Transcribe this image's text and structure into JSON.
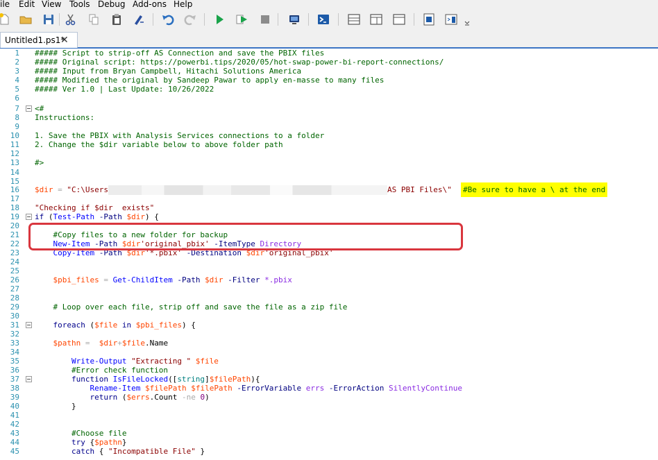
{
  "menubar": {
    "items": [
      "ile",
      "Edit",
      "View",
      "Tools",
      "Debug",
      "Add-ons",
      "Help"
    ]
  },
  "toolbar": {
    "buttons": [
      "new-file-icon",
      "open-folder-icon",
      "save-icon",
      "cut-icon",
      "copy-icon",
      "paste-icon",
      "clear-icon",
      "undo-icon",
      "redo-icon",
      "run-icon",
      "run-selection-icon",
      "stop-icon",
      "remote-powershell-icon",
      "powershell-console-icon",
      "layout-top-icon",
      "layout-right-icon",
      "layout-max-icon",
      "show-commands-icon",
      "command-addon-icon",
      "overflow-chevron-icon"
    ]
  },
  "tab": {
    "label": "Untitled1.ps1*",
    "close": "✕"
  },
  "editor": {
    "line_numbers": [
      "1",
      "2",
      "3",
      "4",
      "5",
      "6",
      "7",
      "8",
      "9",
      "10",
      "11",
      "12",
      "13",
      "14",
      "15",
      "16",
      "17",
      "18",
      "19",
      "20",
      "21",
      "22",
      "23",
      "24",
      "25",
      "26",
      "27",
      "28",
      "29",
      "30",
      "31",
      "32",
      "33",
      "34",
      "35",
      "36",
      "37",
      "38",
      "39",
      "40",
      "41",
      "42",
      "43",
      "44",
      "45"
    ],
    "lines": {
      "l1": "##### Script to strip-off AS Connection and save the PBIX files",
      "l2": "##### Original script: https://powerbi.tips/2020/05/hot-swap-power-bi-report-connections/",
      "l3": "##### Input from Bryan Campbell, Hitachi Solutions America",
      "l4": "##### Modified the original by Sandeep Pawar to apply en-masse to many files",
      "l5": "##### Ver 1.0 | Last Update: 10/26/2022",
      "l7": "<#",
      "l8": "Instructions:",
      "l10": "1. Save the PBIX with Analysis Services connections to a folder",
      "l11": "2. Change the $dir variable below to above folder path",
      "l13": "#>",
      "l16_var": "$dir",
      "l16_op": " = ",
      "l16_str_start": "\"C:\\Users",
      "l16_str_end": "AS PBI Files\\\"",
      "l16_comment": "#Be sure to have a \\ at the end",
      "l18": "\"Checking if $dir  exists\"",
      "l19_kw": "if",
      "l19_rest_a": " (",
      "l19_cmd": "Test-Path",
      "l19_param": " -Path ",
      "l19_var": "$dir",
      "l19_rest_b": ") {",
      "l21": "    #Copy files to a new folder for backup",
      "l22_cmd": "New-Item",
      "l22_p1": " -Path ",
      "l22_var": "$dir",
      "l22_str": "'original_pbix'",
      "l22_p2": " -ItemType ",
      "l22_type": "Directory",
      "l23_cmd": "Copy-Item",
      "l23_p1": " -Path ",
      "l23_var": "$dir",
      "l23_str": "'*.pbix'",
      "l23_p2": " -Destination ",
      "l23_var2": "$dir",
      "l23_str2": "'original_pbix'",
      "l26_var": "$pbi_files",
      "l26_op": " = ",
      "l26_cmd": "Get-ChildItem",
      "l26_p1": " -Path ",
      "l26_var2": "$dir",
      "l26_p2": " -Filter ",
      "l26_val": "*.pbix",
      "l29": "    # Loop over each file, strip off and save the file as a zip file",
      "l31_kw": "foreach",
      "l31_a": " (",
      "l31_var": "$file",
      "l31_in": " in ",
      "l31_var2": "$pbi_files",
      "l31_b": ") {",
      "l33_var": "$pathn",
      "l33_op": " =  ",
      "l33_var2": "$dir",
      "l33_plus": "+",
      "l33_var3": "$file",
      "l33_member": ".Name",
      "l35_cmd": "Write-Output",
      "l35_str": " \"Extracting \"",
      "l35_var": " $file",
      "l36": "        #Error check function",
      "l37_kw": "function",
      "l37_name": " IsFileLocked",
      "l37_a": "([",
      "l37_type": "string",
      "l37_b": "]",
      "l37_var": "$filePath",
      "l37_c": "){",
      "l38_cmd": "Rename-Item",
      "l38_var": " $filePath",
      "l38_var2": " $filePath",
      "l38_p1": " -ErrorVariable ",
      "l38_val": "errs",
      "l38_p2": " -ErrorAction ",
      "l38_type": "SilentlyContinue",
      "l39_kw": "return",
      "l39_a": " (",
      "l39_var": "$errs",
      "l39_member": ".Count",
      "l39_op": " -ne ",
      "l39_num": "0",
      "l39_b": ")",
      "l40": "        }",
      "l43": "        #Choose file",
      "l44_kw": "try",
      "l44_a": " {",
      "l44_var": "$pathn",
      "l44_b": "}",
      "l45_kw": "catch",
      "l45_a": " { ",
      "l45_str": "\"Incompatible File\"",
      "l45_b": " }"
    }
  }
}
